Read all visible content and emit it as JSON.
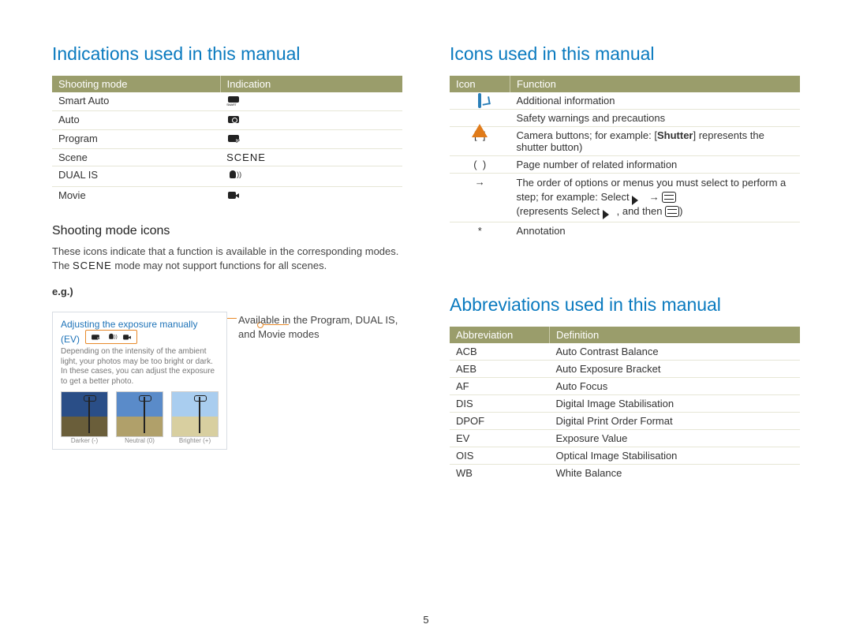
{
  "page_number": "5",
  "left": {
    "title": "Indications used in this manual",
    "table_headers": [
      "Shooting mode",
      "Indication"
    ],
    "modes": [
      {
        "name": "Smart Auto",
        "icon": "smart-auto-icon"
      },
      {
        "name": "Auto",
        "icon": "auto-camera-icon"
      },
      {
        "name": "Program",
        "icon": "program-camera-icon"
      },
      {
        "name": "Scene",
        "icon": "scene-text-icon",
        "text": "SCENE"
      },
      {
        "name": "DUAL IS",
        "icon": "dual-is-icon"
      },
      {
        "name": "Movie",
        "icon": "movie-icon"
      }
    ],
    "subhead": "Shooting mode icons",
    "body_part1": "These icons indicate that a function is available in the corresponding modes. The ",
    "body_scene_word": "SCENE",
    "body_part2": " mode may not support functions for all scenes.",
    "eg_label": "e.g.)",
    "example": {
      "title": "Adjusting the exposure manually (EV)",
      "desc": "Depending on the intensity of the ambient light, your photos may be too bright or dark. In these cases, you can adjust the exposure to get a better photo.",
      "thumbs": [
        "Darker (-)",
        "Neutral (0)",
        "Brighter (+)"
      ]
    },
    "callout": "Available in the Program, DUAL IS, and Movie modes"
  },
  "right": {
    "icons_title": "Icons used in this manual",
    "icons_headers": [
      "Icon",
      "Function"
    ],
    "icons_rows": {
      "note": "Additional information",
      "warn": "Safety warnings and precautions",
      "bracket_sq_prefix": "Camera buttons; for example: [",
      "bracket_sq_bold": "Shutter",
      "bracket_sq_suffix": "] represents the shutter button)",
      "bracket_rd": "Page number of related information",
      "arrow_line1": "The order of options or menus you must select to perform a step; for example: Select ",
      "arrow_line2_mid": " → ",
      "arrow_line3": "(represents Select ",
      "arrow_line3_mid": ", and then ",
      "arrow_line3_end": ")",
      "star": "Annotation"
    },
    "abbr_title": "Abbreviations used in this manual",
    "abbr_headers": [
      "Abbreviation",
      "Definition"
    ],
    "abbr_rows": [
      {
        "k": "ACB",
        "v": "Auto Contrast Balance"
      },
      {
        "k": "AEB",
        "v": "Auto Exposure Bracket"
      },
      {
        "k": "AF",
        "v": "Auto Focus"
      },
      {
        "k": "DIS",
        "v": "Digital Image Stabilisation"
      },
      {
        "k": "DPOF",
        "v": "Digital Print Order Format"
      },
      {
        "k": "EV",
        "v": "Exposure Value"
      },
      {
        "k": "OIS",
        "v": "Optical Image Stabilisation"
      },
      {
        "k": "WB",
        "v": "White Balance"
      }
    ]
  },
  "symbols": {
    "sq_open": "[",
    "sq_close": "]",
    "rd_open": "(",
    "rd_close": ")",
    "arrow": "→",
    "star": "*"
  }
}
